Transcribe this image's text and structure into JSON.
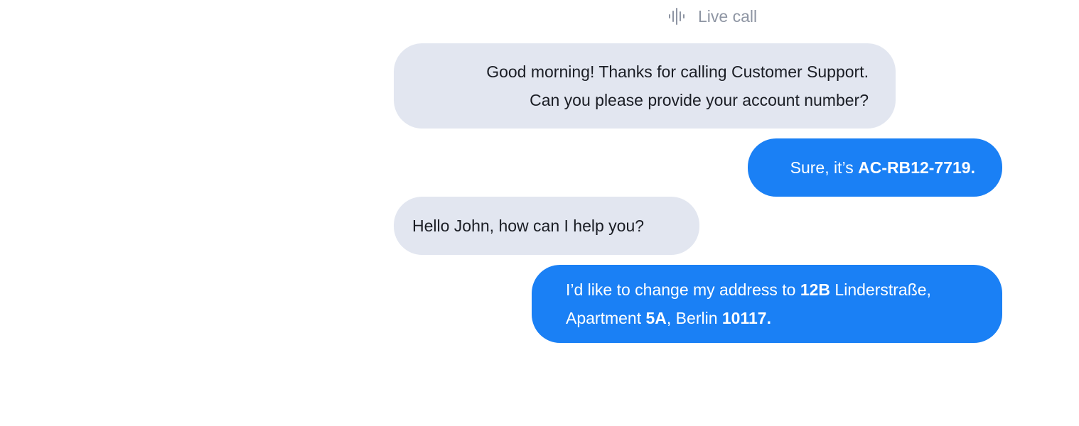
{
  "header": {
    "icon": "audio-wave-icon",
    "label": "Live call"
  },
  "messages": [
    {
      "role": "agent",
      "lines": [
        "Good morning! Thanks for calling Customer Support.",
        "Can you please provide your account number?"
      ]
    },
    {
      "role": "user",
      "text_prefix": "Sure, it’s ",
      "text_bold": "AC-RB12-7719."
    },
    {
      "role": "agent",
      "text": "Hello John, how can I help you?"
    },
    {
      "role": "user",
      "line1_prefix": "I’d like to change my address to ",
      "line1_bold": "12B",
      "line1_suffix": " Linderstraße,",
      "line2_prefix": "Apartment ",
      "line2_bold1": "5A",
      "line2_middle": ", Berlin ",
      "line2_bold2": "10117."
    }
  ],
  "colors": {
    "agent_bubble": "#e2e6f0",
    "user_bubble": "#1a80f5",
    "muted_text": "#8e95a3"
  }
}
